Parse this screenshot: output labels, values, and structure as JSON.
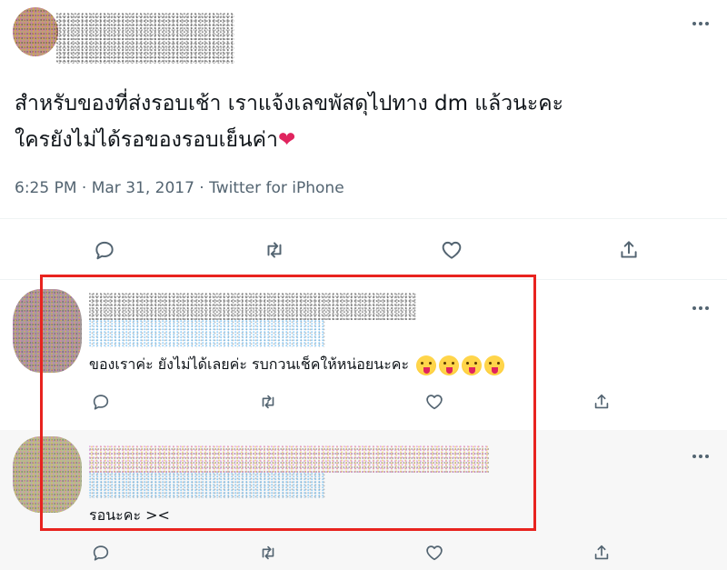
{
  "tweet": {
    "text_line1": "สำหรับของที่ส่งรอบเช้า เราแจ้งเลขพัสดุไปทาง dm แล้วนะคะ",
    "text_line2": "ใครยังไม่ได้รอของรอบเย็นค่า",
    "heart_emoji": "❤",
    "time": "6:25 PM",
    "date": "Mar 31, 2017",
    "source": "Twitter for iPhone",
    "separator": " · "
  },
  "replies": [
    {
      "text": "ของเราค่ะ ยังไม่ได้เลยค่ะ รบกวนเช็คให้หน่อยนะคะ"
    },
    {
      "text": "รอนะคะ ><"
    }
  ],
  "icons": {
    "reply": "reply-icon",
    "retweet": "retweet-icon",
    "like": "like-icon",
    "share": "share-icon",
    "more": "more-icon",
    "emoji": "tongue-out-emoji"
  },
  "colors": {
    "highlight_border": "#e8231f",
    "secondary_text": "#536471",
    "heart": "#e0245e"
  }
}
